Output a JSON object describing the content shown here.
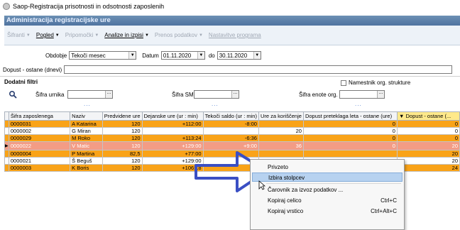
{
  "window": {
    "title": "Saop-Registracija prisotnosti in odsotnosti zaposlenih",
    "app_icon": "app-logo-icon"
  },
  "header": {
    "title": "Administracija registracijske ure"
  },
  "toolbar": {
    "items": [
      {
        "label": "Šifranti",
        "enabled": false,
        "dropdown": true
      },
      {
        "label": "Pogled",
        "enabled": true,
        "dropdown": true
      },
      {
        "label": "Pripomočki",
        "enabled": false,
        "dropdown": true
      },
      {
        "label": "Analize in izpisi",
        "enabled": true,
        "dropdown": true
      },
      {
        "label": "Prenos podatkov",
        "enabled": false,
        "dropdown": true
      },
      {
        "label": "Nastavitve programa",
        "enabled": false,
        "dropdown": false
      }
    ]
  },
  "filter": {
    "obdobje_label": "Obdobje",
    "obdobje_value": "Tekoči mesec",
    "datum_label": "Datum",
    "datum_from": "01.11.2020",
    "do_label": "do",
    "datum_to": "30.11.2020",
    "dopust_label": "Dopust - ostane (dnevi)",
    "dopust_value": ""
  },
  "dodatni": {
    "title": "Dodatni filtri",
    "namestnik_label": "Namestnik org. strukture",
    "sifra_urnika_label": "Šifra urnika",
    "sifra_sm_label": "Šifra SM",
    "sifra_enote_label": "Šifra enote org.",
    "lookup_btn": "...",
    "dots": "..."
  },
  "grid": {
    "columns": [
      "Šifra zaposlenega",
      "Naziv",
      "Predvidene ure",
      "Dejanske ure (ur : min)",
      "Tekoči saldo (ur : min)",
      "Ure za koriščenje",
      "Dopust preteklaga leta - ostane (ure)",
      "Dopust - ostane (..."
    ],
    "sort_indicator": "▼",
    "rows": [
      {
        "style": "orange",
        "id": "0000031",
        "name": "A Katarina",
        "pred": "120",
        "dej": "+112:00",
        "saldo": "-8:00",
        "ure": "",
        "prev": "0",
        "dop": "0"
      },
      {
        "style": "white",
        "id": "0000002",
        "name": "G Miran",
        "pred": "120",
        "dej": "",
        "saldo": "",
        "ure": "20",
        "prev": "0",
        "dop": "0"
      },
      {
        "style": "orange",
        "id": "0000029",
        "name": "M Roko",
        "pred": "120",
        "dej": "+113:24",
        "saldo": "-6:36",
        "ure": "",
        "prev": "0",
        "dop": "0"
      },
      {
        "style": "salmon current",
        "id": "0000022",
        "name": "V Matic",
        "pred": "120",
        "dej": "+129:00",
        "saldo": "+9:00",
        "ure": "36",
        "prev": "0",
        "dop": "20"
      },
      {
        "style": "orange",
        "id": "0000004",
        "name": "P Martina",
        "pred": "82,5",
        "dej": "+77:00",
        "saldo": "",
        "ure": "",
        "prev": "",
        "dop": "20"
      },
      {
        "style": "white",
        "id": "0000021",
        "name": "Š Beguš",
        "pred": "120",
        "dej": "+129:00",
        "saldo": "",
        "ure": "",
        "prev": "",
        "dop": "20"
      },
      {
        "style": "orange",
        "id": "0000003",
        "name": "K Boris",
        "pred": "120",
        "dej": "+106:18",
        "saldo": "",
        "ure": "",
        "prev": "",
        "dop": "24"
      }
    ]
  },
  "context_menu": {
    "items": [
      {
        "label": "Privzeto",
        "shortcut": ""
      },
      {
        "label": "Izbira stolpcev",
        "shortcut": "",
        "highlighted": true
      },
      {
        "label": "Čarovnik za izvoz podatkov ...",
        "shortcut": ""
      },
      {
        "label": "Kopiraj celico",
        "shortcut": "Ctrl+C"
      },
      {
        "label": "Kopiraj vrstico",
        "shortcut": "Ctrl+Alt+C"
      }
    ]
  },
  "annotation": {
    "arrow_color": "#3a4fc4"
  }
}
